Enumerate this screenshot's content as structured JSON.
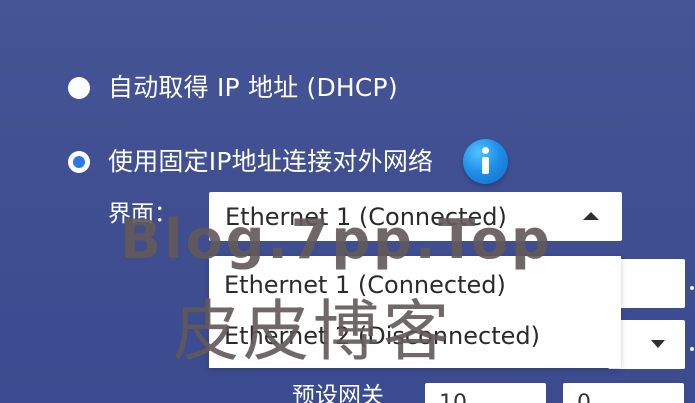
{
  "network_settings": {
    "auto_ip_label": "自动取得 IP 地址 (DHCP)",
    "static_ip_label": "使用固定IP地址连接对外网络",
    "interface_label": "界面：",
    "selected_interface": "Ethernet 1 (Connected)",
    "interface_options": [
      "Ethernet 1 (Connected)",
      "Ethernet 2 (Disconnected)"
    ],
    "gateway_label": "预设网关",
    "gateway_values": [
      "10",
      "0"
    ]
  },
  "watermark": {
    "line1": "Blog.7pp.Top",
    "line2": "皮皮博客"
  },
  "colors": {
    "background": "#3f4f91",
    "radio_selected": "#2f76e7",
    "info_icon": "#1e8ee7",
    "field_background": "#ffffff",
    "field_text": "#2b2b2b",
    "label_text": "#ffffff",
    "watermark": "#645c5c"
  },
  "icons": {
    "info": "info-icon",
    "dropdown_open": "caret-up-icon",
    "dropdown_closed": "caret-down-icon"
  }
}
